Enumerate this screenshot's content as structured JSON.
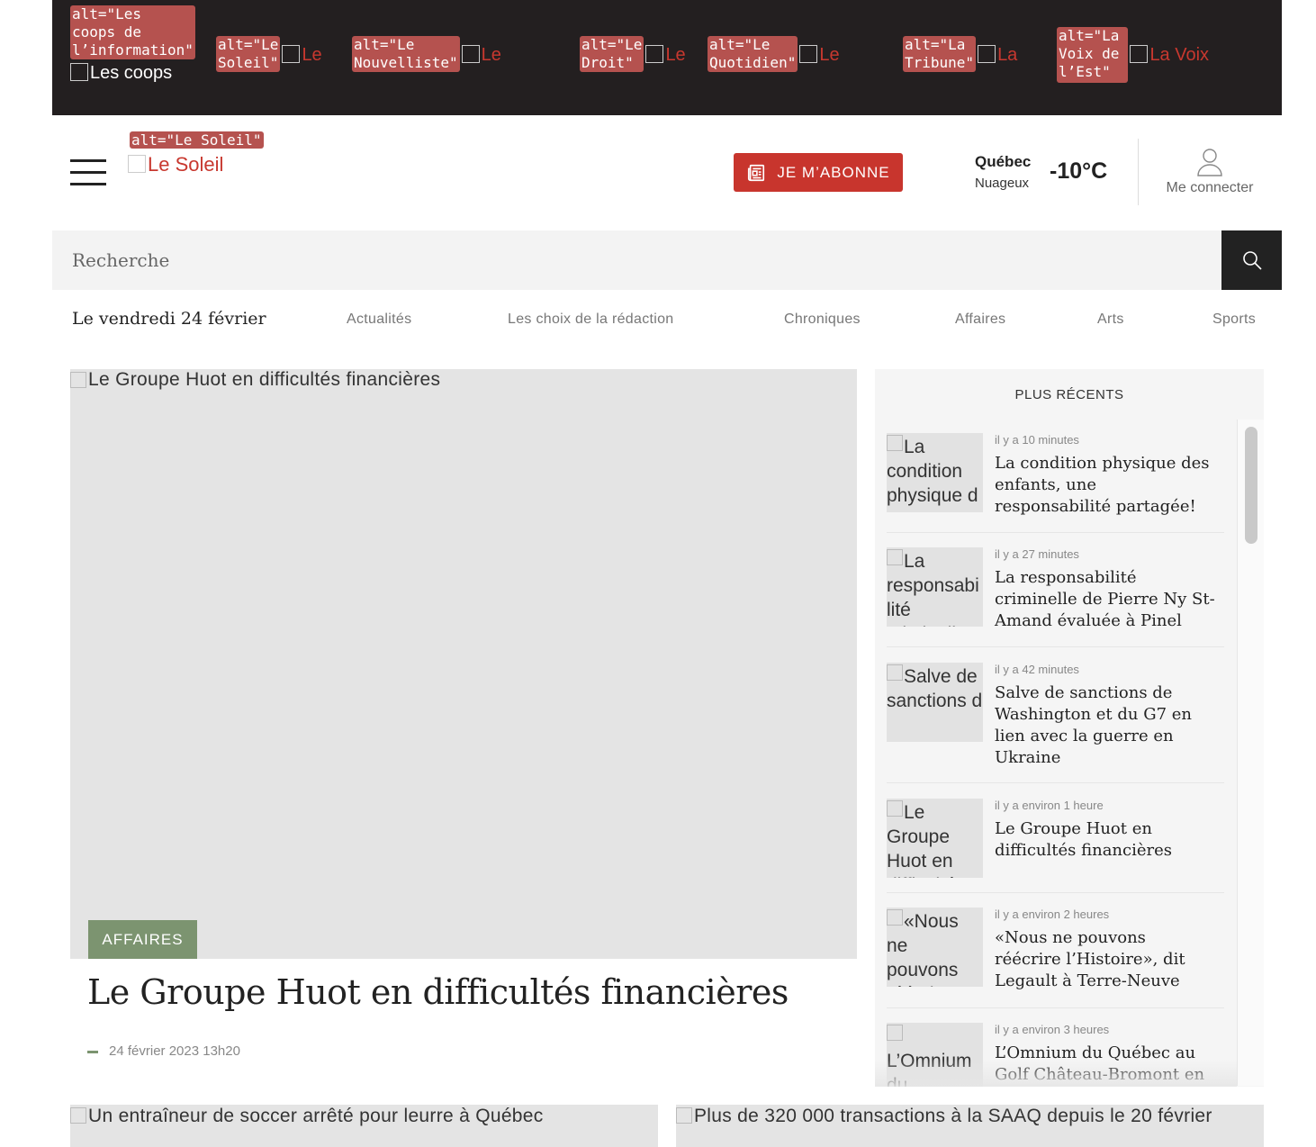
{
  "coops_bar": {
    "items": [
      {
        "alt": "alt=\"Les\ncoops de\nl’information\"",
        "name": ""
      },
      {
        "alt": "alt=\"Le\nSoleil\"",
        "name": "Le"
      },
      {
        "alt": "alt=\"Le\nNouvelliste\"",
        "name": "Le"
      },
      {
        "alt": "alt=\"Le\nDroit\"",
        "name": "Le"
      },
      {
        "alt": "alt=\"Le\nQuotidien\"",
        "name": "Le"
      },
      {
        "alt": "alt=\"La\nTribune\"",
        "name": "La"
      },
      {
        "alt": "alt=\"La\nVoix de\nl’Est\"",
        "name": "La Voix"
      }
    ],
    "home_label": "Les coops"
  },
  "header": {
    "logo_alt": "alt=\"Le Soleil\"",
    "logo_text": "Le Soleil",
    "subscribe_label": "JE M’ABONNE",
    "weather": {
      "city": "Québec",
      "condition": "Nuageux",
      "temperature": "-10°C"
    },
    "login_label": "Me connecter"
  },
  "search": {
    "placeholder": "Recherche"
  },
  "nav": {
    "date": "Le vendredi 24 février",
    "items": [
      "Actualités",
      "Les choix de la rédaction",
      "Chroniques",
      "Affaires",
      "Arts",
      "Sports"
    ]
  },
  "hero": {
    "image_alt": "Le Groupe Huot en difficultés financières",
    "category": "AFFAIRES",
    "title": "Le Groupe Huot en difficultés financières",
    "date": "24 février 2023 13h20"
  },
  "sidebar": {
    "title": "PLUS RÉCENTS",
    "items": [
      {
        "thumb_alt": "La condition physique d",
        "time": "il y a 10 minutes",
        "headline": "La condition physique des enfants, une responsabilité partagée!"
      },
      {
        "thumb_alt": "La responsabilité criminelle de Pi",
        "time": "il y a 27 minutes",
        "headline": "La responsabilité criminelle de Pierre Ny St-Amand évaluée à Pinel"
      },
      {
        "thumb_alt": "Salve de sanctions d",
        "time": "il y a 42 minutes",
        "headline": "Salve de sanctions de Washington et du G7 en lien avec la guerre en Ukraine"
      },
      {
        "thumb_alt": "Le Groupe Huot en difficultés",
        "time": "il y a environ 1 heure",
        "headline": "Le Groupe Huot en difficultés financières"
      },
      {
        "thumb_alt": "«Nous ne pouvons réécrire",
        "time": "il y a environ 2 heures",
        "headline": "«Nous ne pouvons réécrire l’Histoire», dit Legault à Terre-Neuve"
      },
      {
        "thumb_alt": "L’Omnium du",
        "time": "il y a environ 3 heures",
        "headline": "L’Omnium du Québec au Golf Château-Bromont en"
      }
    ]
  },
  "bottom_cards": [
    {
      "image_alt": "Un entraîneur de soccer arrêté pour leurre à Québec"
    },
    {
      "image_alt": "Plus de 320 000 transactions à la SAAQ depuis le 20 février"
    }
  ],
  "colors": {
    "brand_red": "#c8352d",
    "category_green": "#7c9470",
    "topbar": "#231f20"
  }
}
